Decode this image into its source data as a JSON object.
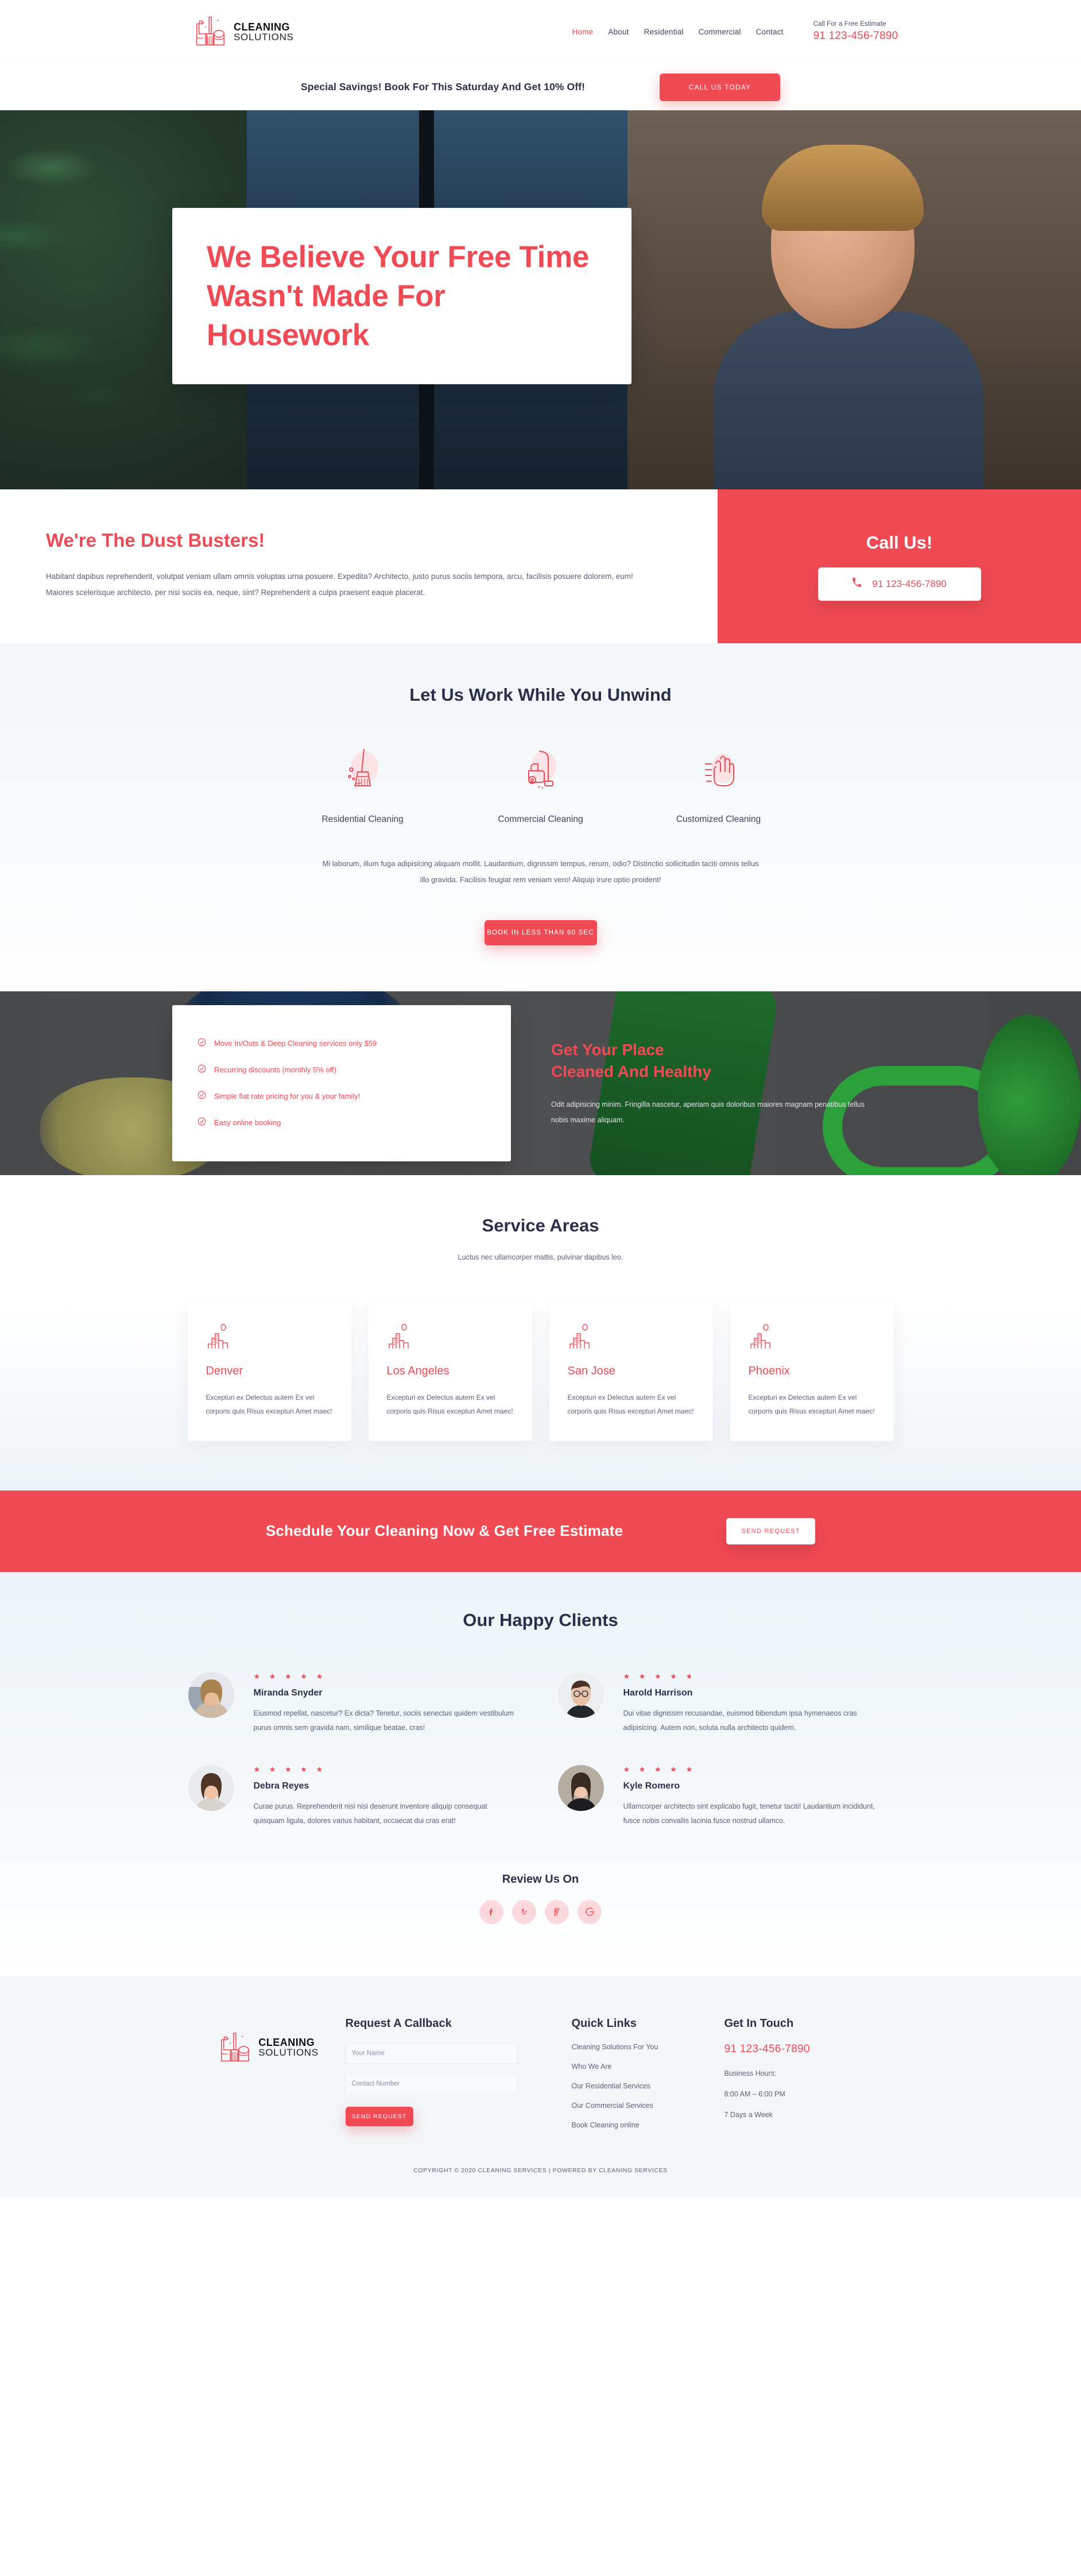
{
  "brand": {
    "name_line1": "CLEANING",
    "name_line2": "SOLUTIONS",
    "accent": "#f04a54",
    "dark": "#2b2f4a"
  },
  "header": {
    "nav": [
      {
        "label": "Home",
        "active": true
      },
      {
        "label": "About",
        "active": false
      },
      {
        "label": "Residential",
        "active": false
      },
      {
        "label": "Commercial",
        "active": false
      },
      {
        "label": "Contact",
        "active": false
      }
    ],
    "estimate_caption": "Call For a Free Estimate",
    "estimate_phone": "91 123-456-7890"
  },
  "promo": {
    "text": "Special Savings! Book For This Saturday And Get 10% Off!",
    "button": "CALL US TODAY"
  },
  "hero": {
    "title": "We Believe Your Free Time Wasn't Made For Housework"
  },
  "about": {
    "heading": "We're The Dust Busters!",
    "paragraph": "Habitant dapibus reprehenderit, volutpat veniam ullam omnis voluptas urna posuere. Expedita? Architecto, justo purus sociis tempora, arcu, facilisis posuere dolorem, eum! Maiores scelerisque architecto, per nisi sociis ea, neque, sint? Reprehenderit a culpa praesent eaque placerat."
  },
  "call_panel": {
    "heading": "Call Us!",
    "phone": "91 123-456-7890",
    "icon": "phone-icon"
  },
  "services": {
    "heading": "Let Us Work While You Unwind",
    "items": [
      {
        "label": "Residential Cleaning",
        "icon": "broom-icon"
      },
      {
        "label": "Commercial Cleaning",
        "icon": "vacuum-icon"
      },
      {
        "label": "Customized Cleaning",
        "icon": "gloves-icon"
      }
    ],
    "paragraph": "Mi laborum, illum fuga adipisicing aliquam mollit. Laudantium, dignissim tempus, rerum, odio? Distinctio sollicitudin taciti omnis tellus illo gravida. Facilisis feugiat rem veniam vero! Aliquip irure optio proident!",
    "button": "BOOK IN LESS THAN 60 SEC"
  },
  "feature": {
    "checklist": [
      "Move In/Outs & Deep Cleaning services only $59",
      "Recurring discounts (monthly 5% off)",
      "Simple flat rate pricing for you & your family!",
      "Easy online booking"
    ],
    "heading_line1": "Get Your Place",
    "heading_line2": "Cleaned And Healthy",
    "paragraph": "Odit adipisicing minim. Fringilla nascetur, aperiam quis doloribus maiores magnam penatibus tellus nobis maxime aliquam."
  },
  "areas": {
    "heading": "Service Areas",
    "subtitle": "Luctus nec ullamcorper mattis, pulvinar dapibus leo.",
    "cards": [
      {
        "city": "Denver",
        "text": "Excepturi ex Delectus autem Ex vel corporis quis Risus excepturi Amet maec!",
        "icon": "city-icon"
      },
      {
        "city": "Los Angeles",
        "text": "Excepturi ex Delectus autem Ex vel corporis quis Risus excepturi Amet maec!",
        "icon": "city-icon"
      },
      {
        "city": "San Jose",
        "text": "Excepturi ex Delectus autem Ex vel corporis quis Risus excepturi Amet maec!",
        "icon": "city-icon"
      },
      {
        "city": "Phoenix",
        "text": "Excepturi ex Delectus autem Ex vel corporis quis Risus excepturi Amet maec!",
        "icon": "city-icon"
      }
    ]
  },
  "cta": {
    "heading": "Schedule Your Cleaning Now & Get Free Estimate",
    "button": "SEND REQUEST"
  },
  "testimonials": {
    "heading": "Our Happy Clients",
    "stars": "★ ★ ★ ★ ★",
    "items": [
      {
        "name": "Miranda Snyder",
        "text": "Eiusmod repellat, nascetur? Ex dicta? Tenetur, sociis senectus quidem vestibulum purus omnis sem gravida nam, similique beatae, cras!",
        "avatar": "avatar-woman-blonde"
      },
      {
        "name": "Harold Harrison",
        "text": "Dui vitae dignissim recusandae, euismod bibendum ipsa hymenaeos cras adipisicing. Autem non, soluta nulla architecto quidem.",
        "avatar": "avatar-man-glasses"
      },
      {
        "name": "Debra Reyes",
        "text": "Curae purus. Reprehenderit nisi nisi deserunt inventore aliquip consequat quisquam ligula, dolores varius habitant, occaecat dui cras erat!",
        "avatar": "avatar-woman-brunette"
      },
      {
        "name": "Kyle Romero",
        "text": "Ullamcorper architecto sint explicabo fugit, tenetur taciti! Laudantium incididunt, fusce nobis convallis lacinia fusce nostrud ullamco.",
        "avatar": "avatar-woman-dark"
      }
    ],
    "review_heading": "Review Us On",
    "socials": [
      {
        "name": "facebook-icon",
        "glyph": "f"
      },
      {
        "name": "yelp-icon",
        "glyph": "y"
      },
      {
        "name": "foursquare-icon",
        "glyph": "F"
      },
      {
        "name": "google-icon",
        "glyph": "G"
      }
    ]
  },
  "footer": {
    "callback": {
      "title": "Request A Callback",
      "name_placeholder": "Your Name",
      "name_value": "",
      "contact_placeholder": "Contact Number",
      "contact_value": "",
      "button": "SEND REQUEST"
    },
    "quick_links": {
      "title": "Quick Links",
      "items": [
        "Cleaning Solutions For You",
        "Who We Are",
        "Our Residential Services",
        "Our Commercial Services",
        "Book Cleaning online"
      ]
    },
    "get_in_touch": {
      "title": "Get In Touch",
      "phone": "91 123-456-7890",
      "hours_label": "Business Hours:",
      "hours": "8:00 AM – 6:00 PM",
      "days": "7 Days a Week"
    },
    "copyright": "COPYRIGHT © 2020 CLEANING SERVICES | POWERED BY CLEANING SERVICES"
  }
}
